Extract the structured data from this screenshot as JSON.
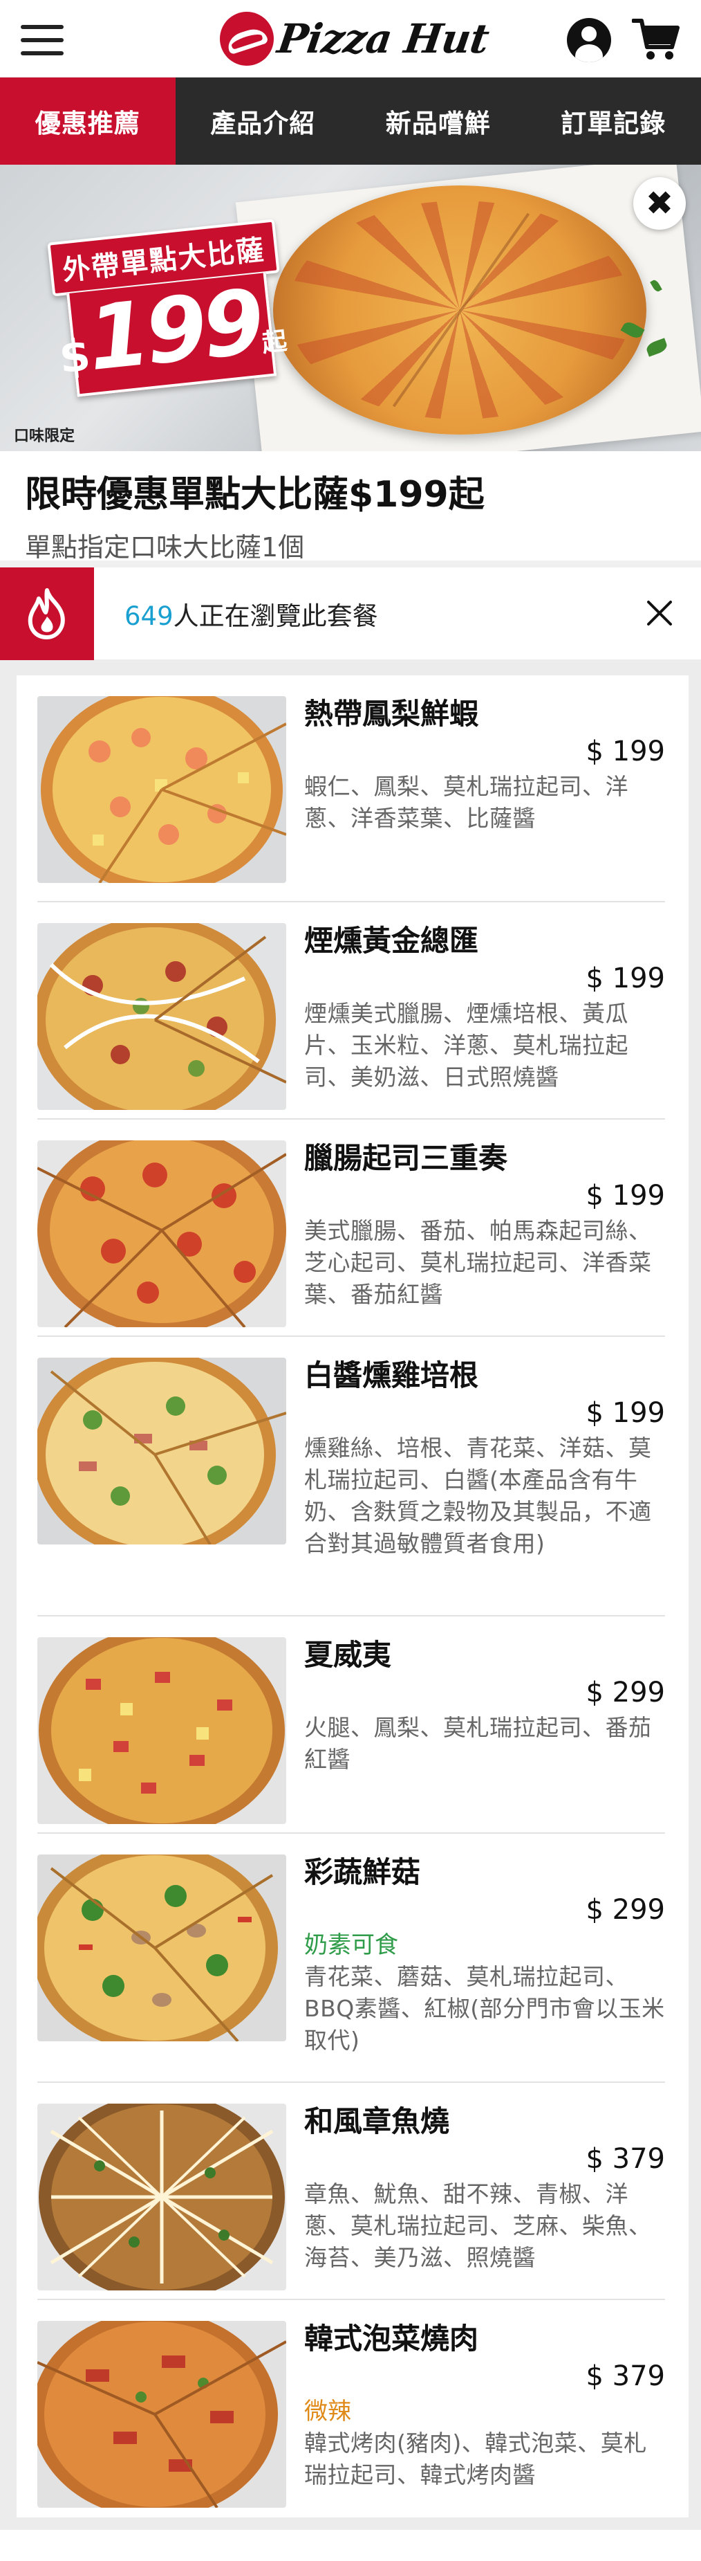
{
  "header": {
    "logo_text": "Pizza Hut",
    "menu_icon": "hamburger-menu-icon",
    "account_icon": "user-account-icon",
    "cart_icon": "shopping-cart-icon"
  },
  "tabs": [
    {
      "label": "優惠推薦",
      "active": true
    },
    {
      "label": "產品介紹",
      "active": false
    },
    {
      "label": "新品嚐鮮",
      "active": false
    },
    {
      "label": "訂單記錄",
      "active": false
    }
  ],
  "banner": {
    "headline": "外帶單點大比薩",
    "currency": "$",
    "price": "199",
    "suffix": "起",
    "note": "口味限定",
    "close_icon": "close-icon"
  },
  "promo": {
    "title": "限時優惠單點大比薩$199起",
    "subtitle": "單點指定口味大比薩1個"
  },
  "viewer": {
    "count": "649",
    "text": "人正在瀏覽此套餐",
    "flame_icon": "flame-icon",
    "close_icon": "close-icon"
  },
  "items": [
    {
      "name": "熱帶鳳梨鮮蝦",
      "price": "$ 199",
      "tag": "",
      "desc": "蝦仁、鳳梨、莫札瑞拉起司、洋蔥、洋香菜葉、比薩醬"
    },
    {
      "name": "煙燻黃金總匯",
      "price": "$ 199",
      "tag": "",
      "desc": "煙燻美式臘腸、煙燻培根、黃瓜片、玉米粒、洋蔥、莫札瑞拉起司、美奶滋、日式照燒醬"
    },
    {
      "name": "臘腸起司三重奏",
      "price": "$ 199",
      "tag": "",
      "desc": "美式臘腸、番茄、帕馬森起司絲、芝心起司、莫札瑞拉起司、洋香菜葉、番茄紅醬"
    },
    {
      "name": "白醬燻雞培根",
      "price": "$ 199",
      "tag": "",
      "desc": "燻雞絲、培根、青花菜、洋菇、莫札瑞拉起司、白醬(本產品含有牛奶、含麩質之穀物及其製品，不適合對其過敏體質者食用)"
    },
    {
      "name": "夏威夷",
      "price": "$ 299",
      "tag": "",
      "desc": "火腿、鳳梨、莫札瑞拉起司、番茄紅醬"
    },
    {
      "name": "彩蔬鮮菇",
      "price": "$ 299",
      "tag": "奶素可食",
      "tag_type": "veg",
      "desc": "青花菜、蘑菇、莫札瑞拉起司、BBQ素醬、紅椒(部分門市會以玉米取代)"
    },
    {
      "name": "和風章魚燒",
      "price": "$ 379",
      "tag": "",
      "desc": "章魚、魷魚、甜不辣、青椒、洋蔥、莫札瑞拉起司、芝麻、柴魚、海苔、美乃滋、照燒醬"
    },
    {
      "name": "韓式泡菜燒肉",
      "price": "$ 379",
      "tag": "微辣",
      "tag_type": "spicy",
      "desc": "韓式烤肉(豬肉)、韓式泡菜、莫札瑞拉起司、韓式烤肉醬"
    }
  ],
  "colors": {
    "brand_red": "#c8102e",
    "tab_bar": "#2b2b2b",
    "viewer_count": "#1aa0d0",
    "veg_green": "#2f9c49",
    "spicy_orange": "#e08a1a"
  }
}
